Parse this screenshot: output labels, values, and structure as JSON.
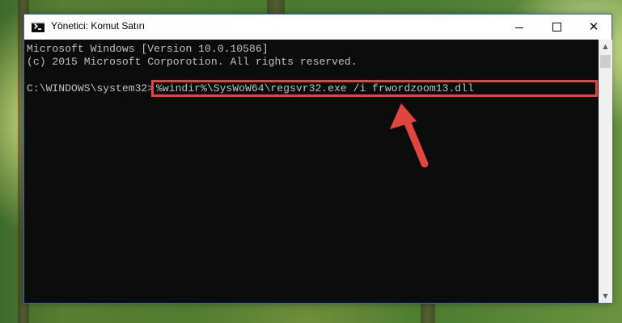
{
  "window": {
    "title": "Yönetici: Komut Satırı",
    "controls": {
      "minimize": "",
      "maximize": "",
      "close": "✕"
    }
  },
  "console": {
    "lines": [
      "Microsoft Windows [Version 10.0.10586]",
      "(c) 2015 Microsoft Corporotion. All rights reserved."
    ],
    "prompt": "C:\\WINDOWS\\system32>",
    "command": "%windir%\\SysWoW64\\regsvr32.exe /i frwordzoom13.dll"
  },
  "scrollbar": {
    "up": "▲",
    "down": "▼"
  },
  "colors": {
    "console_bg": "#0c0c0c",
    "console_text": "#c0c0c0",
    "highlight": "#e0453f",
    "arrow": "#e0453f"
  }
}
